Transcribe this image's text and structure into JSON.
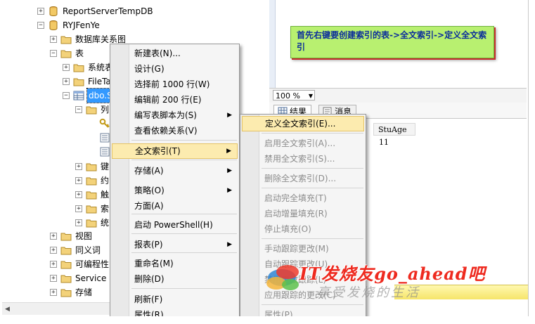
{
  "tree": {
    "rows": [
      {
        "label": "ReportServerTempDB",
        "icon": "database-icon"
      },
      {
        "label": "RYJFenYe",
        "icon": "database-icon"
      },
      {
        "label": "数据库关系图",
        "icon": "folder-icon"
      },
      {
        "label": "表",
        "icon": "folder-icon"
      },
      {
        "label": "系统表",
        "icon": "folder-icon"
      },
      {
        "label": "FileTa",
        "icon": "folder-icon"
      },
      {
        "label": "dbo.S",
        "icon": "table-icon"
      },
      {
        "label": "列",
        "icon": "folder-icon"
      },
      {
        "label": "键",
        "icon": "folder-icon"
      },
      {
        "label": "约",
        "icon": "folder-icon"
      },
      {
        "label": "触",
        "icon": "folder-icon"
      },
      {
        "label": "索",
        "icon": "folder-icon"
      },
      {
        "label": "统",
        "icon": "folder-icon"
      },
      {
        "label": "视图",
        "icon": "folder-icon"
      },
      {
        "label": "同义词",
        "icon": "folder-icon"
      },
      {
        "label": "可编程性",
        "icon": "folder-icon"
      },
      {
        "label": "Service B",
        "icon": "folder-icon"
      },
      {
        "label": "存储",
        "icon": "folder-icon"
      }
    ]
  },
  "editor": {
    "note": "首先右键要创建索引的表->全文索引->定义全文索引",
    "zoom": "100 %",
    "tabs": {
      "results": "结果",
      "messages": "消息"
    },
    "grid": {
      "header": "StuAge",
      "value": "11"
    }
  },
  "context_menu": {
    "items": [
      {
        "label": "新建表(N)...",
        "submenu": false
      },
      {
        "label": "设计(G)",
        "submenu": false
      },
      {
        "label": "选择前 1000 行(W)",
        "submenu": false
      },
      {
        "label": "编辑前 200 行(E)",
        "submenu": false
      },
      {
        "label": "编写表脚本为(S)",
        "submenu": true
      },
      {
        "label": "查看依赖关系(V)",
        "submenu": false
      },
      {
        "label": "全文索引(T)",
        "submenu": true,
        "highlighted": true
      },
      {
        "label": "存储(A)",
        "submenu": true
      },
      {
        "label": "策略(O)",
        "submenu": true
      },
      {
        "label": "方面(A)",
        "submenu": false
      },
      {
        "label": "启动 PowerShell(H)",
        "submenu": false
      },
      {
        "label": "报表(P)",
        "submenu": true
      },
      {
        "label": "重命名(M)",
        "submenu": false
      },
      {
        "label": "删除(D)",
        "submenu": false
      },
      {
        "label": "刷新(F)",
        "submenu": false
      },
      {
        "label": "属性(R)",
        "submenu": false
      }
    ]
  },
  "fulltext_submenu": {
    "items": [
      {
        "label": "定义全文索引(E)...",
        "enabled": true,
        "highlighted": true
      },
      {
        "label": "启用全文索引(A)...",
        "enabled": false
      },
      {
        "label": "禁用全文索引(S)...",
        "enabled": false
      },
      {
        "label": "删除全文索引(D)...",
        "enabled": false
      },
      {
        "label": "启动完全填充(T)",
        "enabled": false
      },
      {
        "label": "启动增量填充(R)",
        "enabled": false
      },
      {
        "label": "停止填充(O)",
        "enabled": false
      },
      {
        "label": "手动跟踪更改(M)",
        "enabled": false
      },
      {
        "label": "自动跟踪更改(U)",
        "enabled": false
      },
      {
        "label": "禁用更改跟踪(L)",
        "enabled": false
      },
      {
        "label": "应用跟踪的更改(C)",
        "enabled": false
      },
      {
        "label": "属性(P)",
        "enabled": false
      }
    ]
  },
  "watermark": {
    "title": "IT发烧友go_ahead吧",
    "subtitle": "享受发烧的生活"
  },
  "colors": {
    "note_bg": "#b8f070",
    "note_text": "#0a2c9c",
    "selection": "#3399ff",
    "menu_highlight": "#fcebaf",
    "watermark": "#ee2a1f"
  }
}
